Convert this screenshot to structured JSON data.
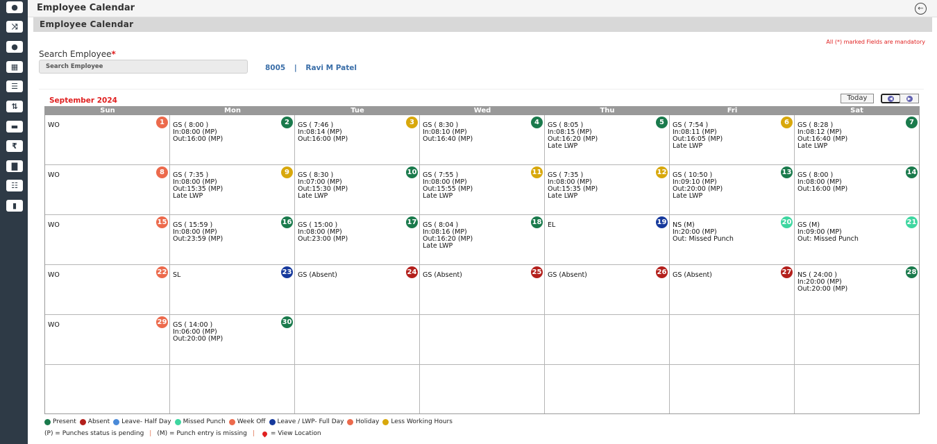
{
  "app": {
    "title": "Employee Calendar"
  },
  "sidebar": {
    "items": [
      {
        "icon": "info-icon",
        "glyph": "●"
      },
      {
        "icon": "shuffle-icon",
        "glyph": "⤨"
      },
      {
        "icon": "users-icon",
        "glyph": "●"
      },
      {
        "icon": "calendar-icon",
        "glyph": "▦"
      },
      {
        "icon": "list-indent-icon",
        "glyph": "☰"
      },
      {
        "icon": "sort-icon",
        "glyph": "⇅"
      },
      {
        "icon": "money-icon",
        "glyph": "▬"
      },
      {
        "icon": "rupee-icon",
        "glyph": "₹"
      },
      {
        "icon": "bar-chart-icon",
        "glyph": "▇"
      },
      {
        "icon": "org-chart-icon",
        "glyph": "☷"
      },
      {
        "icon": "bookmark-icon",
        "glyph": "▮"
      }
    ]
  },
  "panel": {
    "title": "Employee Calendar"
  },
  "form": {
    "mandatory_note": "All (*) marked Fields are mandatory",
    "search_label": "Search Employee",
    "required_mark": "*",
    "search_placeholder": "Search Employee",
    "employee_code": "8005",
    "separator": "|",
    "employee_name": "Ravi M Patel"
  },
  "calendar": {
    "month_label": "September 2024",
    "today_label": "Today",
    "day_names": [
      "Sun",
      "Mon",
      "Tue",
      "Wed",
      "Thu",
      "Fri",
      "Sat"
    ],
    "days": [
      {
        "day": "1",
        "status": "week_off",
        "text": "WO"
      },
      {
        "day": "2",
        "status": "present",
        "text": "GS ( 8:00 )\nIn:08:00 (MP)\nOut:16:00 (MP)"
      },
      {
        "day": "3",
        "status": "less_hours",
        "text": "GS ( 7:46 )\nIn:08:14 (MP)\nOut:16:00 (MP)"
      },
      {
        "day": "4",
        "status": "present",
        "text": "GS ( 8:30 )\nIn:08:10 (MP)\nOut:16:40 (MP)"
      },
      {
        "day": "5",
        "status": "present",
        "text": "GS ( 8:05 )\nIn:08:15 (MP)\nOut:16:20 (MP)\nLate LWP"
      },
      {
        "day": "6",
        "status": "less_hours",
        "text": "GS ( 7:54 )\nIn:08:11 (MP)\nOut:16:05 (MP)\nLate LWP"
      },
      {
        "day": "7",
        "status": "present",
        "text": "GS ( 8:28 )\nIn:08:12 (MP)\nOut:16:40 (MP)\nLate LWP"
      },
      {
        "day": "8",
        "status": "week_off",
        "text": "WO"
      },
      {
        "day": "9",
        "status": "less_hours",
        "text": "GS ( 7:35 )\nIn:08:00 (MP)\nOut:15:35 (MP)\nLate LWP"
      },
      {
        "day": "10",
        "status": "present",
        "text": "GS ( 8:30 )\nIn:07:00 (MP)\nOut:15:30 (MP)\nLate LWP"
      },
      {
        "day": "11",
        "status": "less_hours",
        "text": "GS ( 7:55 )\nIn:08:00 (MP)\nOut:15:55 (MP)\nLate LWP"
      },
      {
        "day": "12",
        "status": "less_hours",
        "text": "GS ( 7:35 )\nIn:08:00 (MP)\nOut:15:35 (MP)\nLate LWP"
      },
      {
        "day": "13",
        "status": "present",
        "text": "GS ( 10:50 )\nIn:09:10 (MP)\nOut:20:00 (MP)\nLate LWP"
      },
      {
        "day": "14",
        "status": "present",
        "text": "GS ( 8:00 )\nIn:08:00 (MP)\nOut:16:00 (MP)"
      },
      {
        "day": "15",
        "status": "week_off",
        "text": "WO"
      },
      {
        "day": "16",
        "status": "present",
        "text": "GS ( 15:59 )\nIn:08:00 (MP)\nOut:23:59 (MP)"
      },
      {
        "day": "17",
        "status": "present",
        "text": "GS ( 15:00 )\nIn:08:00 (MP)\nOut:23:00 (MP)"
      },
      {
        "day": "18",
        "status": "present",
        "text": "GS ( 8:04 )\nIn:08:16 (MP)\nOut:16:20 (MP)\nLate LWP"
      },
      {
        "day": "19",
        "status": "leave_full",
        "text": "EL"
      },
      {
        "day": "20",
        "status": "missed_punch",
        "text": "NS (M)\nIn:20:00 (MP)\nOut: Missed Punch"
      },
      {
        "day": "21",
        "status": "missed_punch",
        "text": "GS (M)\nIn:09:00 (MP)\nOut: Missed Punch"
      },
      {
        "day": "22",
        "status": "week_off",
        "text": "WO"
      },
      {
        "day": "23",
        "status": "leave_full",
        "text": "SL"
      },
      {
        "day": "24",
        "status": "absent",
        "text": "GS (Absent)"
      },
      {
        "day": "25",
        "status": "absent",
        "text": "GS (Absent)"
      },
      {
        "day": "26",
        "status": "absent",
        "text": "GS (Absent)"
      },
      {
        "day": "27",
        "status": "absent",
        "text": "GS (Absent)"
      },
      {
        "day": "28",
        "status": "present",
        "text": "NS ( 24:00 )\nIn:20:00 (MP)\nOut:20:00 (MP)"
      },
      {
        "day": "29",
        "status": "week_off",
        "text": "WO"
      },
      {
        "day": "30",
        "status": "present",
        "text": "GS ( 14:00 )\nIn:06:00 (MP)\nOut:20:00 (MP)"
      }
    ]
  },
  "status_colors": {
    "present": "#1a7a4c",
    "absent": "#b3201c",
    "leave_half": "#4a8ad8",
    "missed_punch": "#3ed6a0",
    "week_off": "#ec6a4c",
    "leave_full": "#16399c",
    "holiday": "#ec6a4c",
    "less_hours": "#d8a80c"
  },
  "legend": [
    {
      "key": "present",
      "label": "Present"
    },
    {
      "key": "absent",
      "label": "Absent"
    },
    {
      "key": "leave_half",
      "label": "Leave- Half Day"
    },
    {
      "key": "missed_punch",
      "label": "Missed Punch"
    },
    {
      "key": "week_off",
      "label": "Week Off"
    },
    {
      "key": "leave_full",
      "label": "Leave / LWP- Full Day"
    },
    {
      "key": "holiday",
      "label": "Holiday"
    },
    {
      "key": "less_hours",
      "label": "Less Working Hours"
    }
  ],
  "notes": {
    "pending": "(P) = Punches status is pending",
    "missing": "(M) = Punch entry is missing",
    "location": "= View Location",
    "separator": "|"
  }
}
